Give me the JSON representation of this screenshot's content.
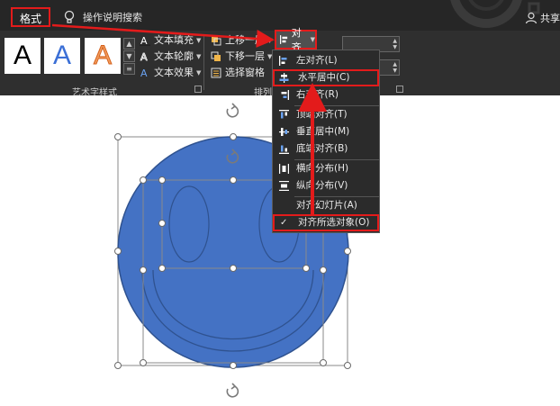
{
  "topbar": {
    "format_tab": "格式",
    "tell_me": "操作说明搜索",
    "share": "共享"
  },
  "ribbon": {
    "art_samples": [
      "A",
      "A",
      "A"
    ],
    "text_fill": "文本填充",
    "text_outline": "文本轮廓",
    "text_effects": "文本效果",
    "art_group_label": "艺术字样式",
    "bring_forward": "上移一层",
    "send_backward": "下移一层",
    "selection_pane": "选择窗格",
    "arrange_group_label": "排列",
    "align_button": "对齐"
  },
  "align_menu": {
    "align_left": "左对齐(L)",
    "align_center": "水平居中(C)",
    "align_right": "右对齐(R)",
    "align_top": "顶端对齐(T)",
    "align_middle": "垂直居中(M)",
    "align_bottom": "底端对齐(B)",
    "distribute_h": "横向分布(H)",
    "distribute_v": "纵向分布(V)",
    "align_to_slide": "对齐幻灯片(A)",
    "align_selected": "对齐所选对象(O)",
    "checkmark": "✓"
  },
  "colors": {
    "highlight": "#e31b1b",
    "shape_fill": "#4472c4",
    "shape_stroke": "#2f528f",
    "ribbon_bg": "#2f2f2f",
    "topbar_bg": "#262626"
  }
}
